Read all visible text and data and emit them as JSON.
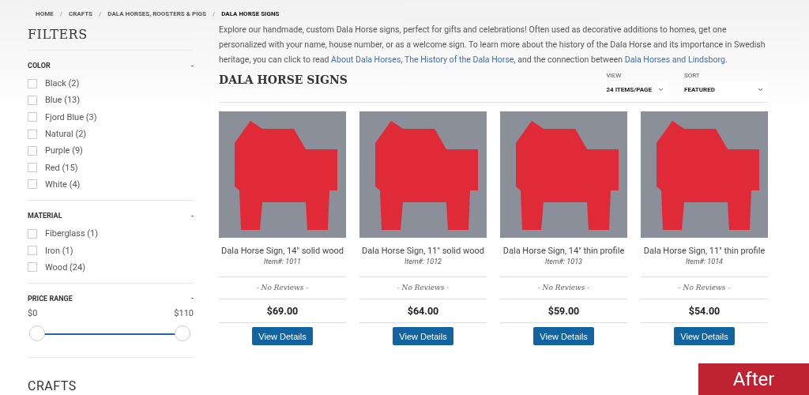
{
  "breadcrumb": [
    {
      "label": "HOME",
      "current": false
    },
    {
      "label": "CRAFTS",
      "current": false
    },
    {
      "label": "DALA HORSES, ROOSTERS & PIGS",
      "current": false
    },
    {
      "label": "DALA HORSE SIGNS",
      "current": true
    }
  ],
  "breadcrumb_separator": "/",
  "filters": {
    "title": "FILTERS",
    "groups": [
      {
        "title": "COLOR",
        "toggle": "-",
        "options": [
          {
            "label": "Black (2)",
            "checked": false
          },
          {
            "label": "Blue (13)",
            "checked": false
          },
          {
            "label": "Fjord Blue (3)",
            "checked": false
          },
          {
            "label": "Natural (2)",
            "checked": false
          },
          {
            "label": "Purple (9)",
            "checked": false
          },
          {
            "label": "Red (15)",
            "checked": false
          },
          {
            "label": "White (4)",
            "checked": false
          }
        ]
      },
      {
        "title": "MATERIAL",
        "toggle": "-",
        "options": [
          {
            "label": "Fiberglass (1)",
            "checked": false
          },
          {
            "label": "Iron (1)",
            "checked": false
          },
          {
            "label": "Wood (24)",
            "checked": false
          }
        ]
      }
    ],
    "price_range": {
      "title": "PRICE RANGE",
      "toggle": "-",
      "min_label": "$0",
      "max_label": "$110",
      "thumbs": [
        {
          "level": 0
        },
        {
          "level": 1
        }
      ]
    },
    "next_section_title": "CRAFTS"
  },
  "intro": [
    {
      "kind": "text",
      "text": "Explore our handmade, custom Dala Horse signs, perfect for gifts and celebrations! Often used as decorative additions to homes, get one personalized with your name, house number, or as a welcome sign. To learn more about the history of the Dala Horse and its importance in Swedish heritage, you can click to read "
    },
    {
      "kind": "link",
      "text": "About Dala Horses"
    },
    {
      "kind": "text",
      "text": ", "
    },
    {
      "kind": "link",
      "text": "The History of the Dala Horse"
    },
    {
      "kind": "text",
      "text": ", and the connection between "
    },
    {
      "kind": "link",
      "text": "Dala Horses and Lindsborg"
    },
    {
      "kind": "text",
      "text": "."
    }
  ],
  "heading": "DALA HORSE SIGNS",
  "view": {
    "label": "VIEW",
    "value": "24 ITEMS/PAGE"
  },
  "sort": {
    "label": "SORT",
    "value": "FEATURED"
  },
  "products": [
    {
      "name": "Dala Horse Sign, 14\" solid wood",
      "item": "Item#: 1011",
      "reviews": "- No Reviews -",
      "price": "$69.00",
      "button": "View Details"
    },
    {
      "name": "Dala Horse Sign, 11\" solid wood",
      "item": "Item#: 1012",
      "reviews": "- No Reviews -",
      "price": "$64.00",
      "button": "View Details"
    },
    {
      "name": "Dala Horse Sign, 14\" thin profile",
      "item": "Item#: 1013",
      "reviews": "- No Reviews -",
      "price": "$59.00",
      "button": "View Details"
    },
    {
      "name": "Dala Horse Sign, 11\" thin profile",
      "item": "Item#: 1014",
      "reviews": "- No Reviews -",
      "price": "$54.00",
      "button": "View Details"
    }
  ],
  "corner_badge": "After"
}
